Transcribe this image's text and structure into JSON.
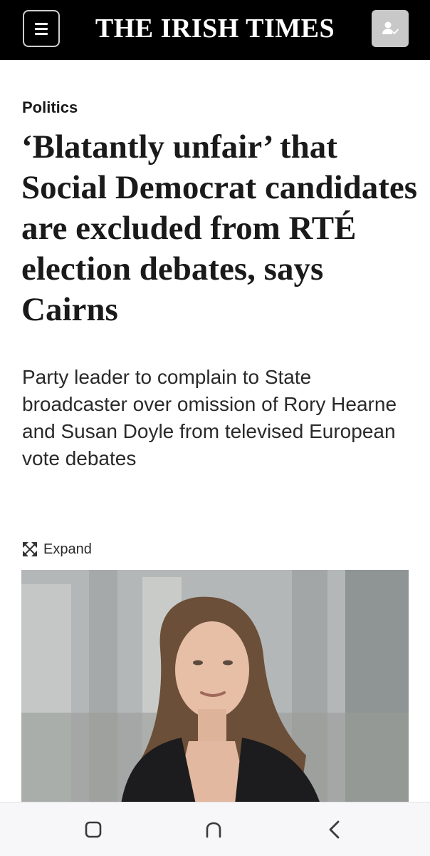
{
  "header": {
    "masthead": "THE IRISH TIMES",
    "menu_icon": "hamburger-icon",
    "account_icon": "account-check-icon"
  },
  "article": {
    "section": "Politics",
    "headline": "‘Blatantly unfair’ that Social Democrat candidates are excluded from RTÉ election debates, says Cairns",
    "standfirst": "Party leader to complain to State broadcaster over omission of Rory Hearne and Susan Doyle from televised European vote debates",
    "expand_label": "Expand",
    "expand_icon": "expand-arrows-icon"
  },
  "navbar": {
    "recents_icon": "recents-square-icon",
    "home_icon": "home-icon",
    "back_icon": "back-chevron-icon"
  },
  "colors": {
    "header_bg": "#000000",
    "text": "#1a1a1a",
    "account_btn_bg": "#c8c8c8",
    "navbar_bg": "#f7f7f9"
  }
}
